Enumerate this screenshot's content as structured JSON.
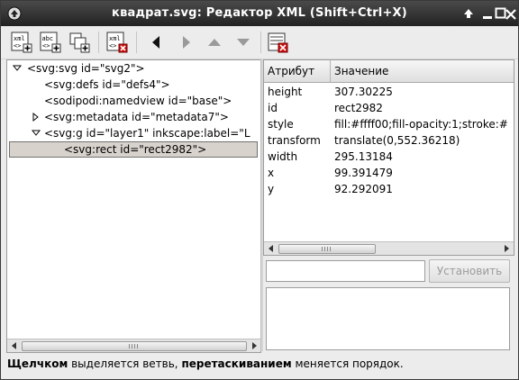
{
  "window": {
    "title": "квадрат.svg: Редактор XML (Shift+Ctrl+X)",
    "controls": [
      "up-arrow-icon",
      "minimize-icon",
      "maximize-icon",
      "close-icon"
    ]
  },
  "toolbar": {
    "buttons": [
      {
        "name": "new-element-node",
        "icon": "xml-new-node-icon",
        "label": "xml"
      },
      {
        "name": "new-text-node",
        "icon": "text-new-node-icon",
        "label": "abc"
      },
      {
        "name": "duplicate-node",
        "icon": "duplicate-node-icon"
      },
      {
        "name": "delete-node",
        "icon": "xml-delete-node-icon",
        "label": "xml"
      },
      {
        "name": "unindent-node",
        "icon": "arrow-left-icon"
      },
      {
        "name": "indent-node",
        "icon": "arrow-right-icon"
      },
      {
        "name": "raise-node",
        "icon": "arrow-up-icon"
      },
      {
        "name": "lower-node",
        "icon": "arrow-down-icon"
      },
      {
        "name": "delete-attribute",
        "icon": "delete-attribute-icon"
      }
    ]
  },
  "tree": {
    "nodes": [
      {
        "label": "<svg:svg id=\"svg2\">",
        "expander": "expanded",
        "depth": 0
      },
      {
        "label": "<svg:defs id=\"defs4\">",
        "expander": "none",
        "depth": 1
      },
      {
        "label": "<sodipodi:namedview id=\"base\">",
        "expander": "none",
        "depth": 1
      },
      {
        "label": "<svg:metadata id=\"metadata7\">",
        "expander": "collapsed",
        "depth": 1
      },
      {
        "label": "<svg:g id=\"layer1\" inkscape:label=\"L",
        "expander": "expanded",
        "depth": 1
      },
      {
        "label": "<svg:rect id=\"rect2982\">",
        "expander": "none",
        "depth": 2,
        "selected": true
      }
    ]
  },
  "attributes": {
    "columns": {
      "name": "Атрибут",
      "value": "Значение"
    },
    "rows": [
      {
        "name": "height",
        "value": "307.30225"
      },
      {
        "name": "id",
        "value": "rect2982"
      },
      {
        "name": "style",
        "value": "fill:#ffff00;fill-opacity:1;stroke:#"
      },
      {
        "name": "transform",
        "value": "translate(0,552.36218)"
      },
      {
        "name": "width",
        "value": "295.13184"
      },
      {
        "name": "x",
        "value": "99.391479"
      },
      {
        "name": "y",
        "value": "92.292091"
      }
    ]
  },
  "editor": {
    "name_value": "",
    "set_button": "Установить",
    "value_text": ""
  },
  "status": {
    "part1_bold": "Щелчком",
    "part2": " выделяется ветвь, ",
    "part3_bold": "перетаскиванием",
    "part4": " меняется порядок."
  },
  "colors": {
    "titlebar": "#2e2e2e",
    "selected_row": "#d8d2cc",
    "disabled_text": "#9b9b9b",
    "delete_red": "#cc1111"
  }
}
